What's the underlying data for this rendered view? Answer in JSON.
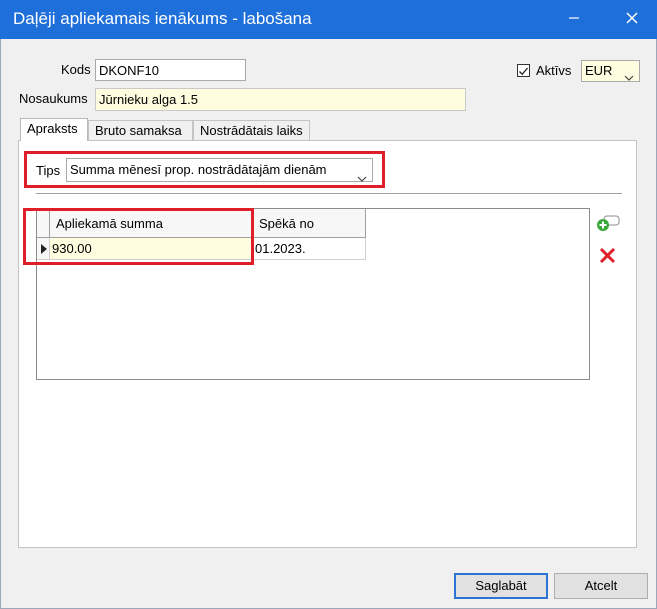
{
  "window": {
    "title": "Daļēji apliekamais ienākums - labošana",
    "controls": {
      "minimize_icon": "minimize-icon",
      "close_icon": "close-icon"
    }
  },
  "form": {
    "kods_label": "Kods",
    "kods_value": "DKONF10",
    "nosaukums_label": "Nosaukums",
    "nosaukums_value": "Jūrnieku alga 1.5",
    "aktivs_label": "Aktīvs",
    "aktivs_checked": true,
    "currency_value": "EUR"
  },
  "tabs": [
    {
      "label": "Apraksts",
      "active": true
    },
    {
      "label": "Bruto samaksa",
      "active": false
    },
    {
      "label": "Nostrādātais laiks",
      "active": false
    }
  ],
  "apraksts": {
    "tips_label": "Tips",
    "tips_value": "Summa mēnesī prop. nostrādātajām dienām"
  },
  "grid": {
    "columns": [
      "Apliekamā summa",
      "Spēkā no"
    ],
    "rows": [
      {
        "apliekama_summa": "930.00",
        "speka_no": "01.2023."
      }
    ]
  },
  "side_buttons": {
    "add_icon": "add-row-icon",
    "delete_icon": "delete-row-icon"
  },
  "footer": {
    "save_label": "Saglabāt",
    "cancel_label": "Atcelt"
  },
  "colors": {
    "titlebar": "#1e6fd9",
    "highlight_red": "#e01e2a",
    "field_yellow": "#fffde0"
  }
}
